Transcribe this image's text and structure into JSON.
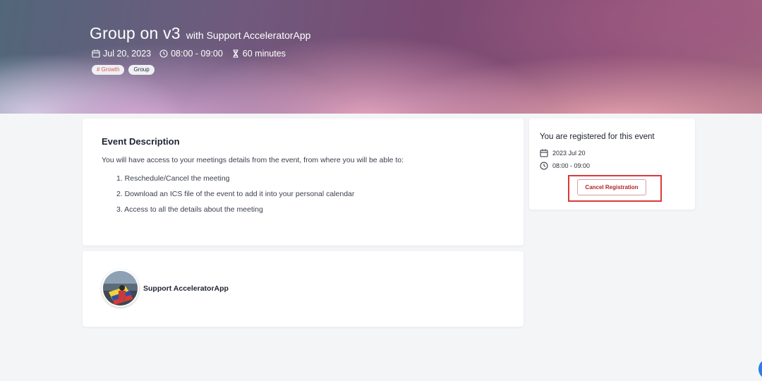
{
  "hero": {
    "title": "Group on v3",
    "with_text": "with Support AcceleratorApp",
    "date": "Jul 20, 2023",
    "time": "08:00 - 09:00",
    "duration": "60 minutes",
    "tags": [
      "# Growth",
      "Group"
    ],
    "icons": {
      "date": "calendar-icon",
      "time": "clock-icon",
      "duration": "hourglass-icon"
    }
  },
  "description": {
    "title": "Event Description",
    "intro": "You will have access to your meetings details from the event, from where you will be able to:",
    "items": [
      "1. Reschedule/Cancel the meeting",
      "2. Download an ICS file of the event to add it into your personal calendar",
      "3. Access to all the details about the meeting"
    ]
  },
  "host": {
    "name": "Support AcceleratorApp"
  },
  "registration": {
    "title": "You are registered for this event",
    "date": "2023 Jul 20",
    "time": "08:00 - 09:00",
    "cancel_label": "Cancel Registration"
  },
  "colors": {
    "highlight": "#d93a3a",
    "tag_growth": "#e2574c",
    "fab": "#2f7be8"
  }
}
